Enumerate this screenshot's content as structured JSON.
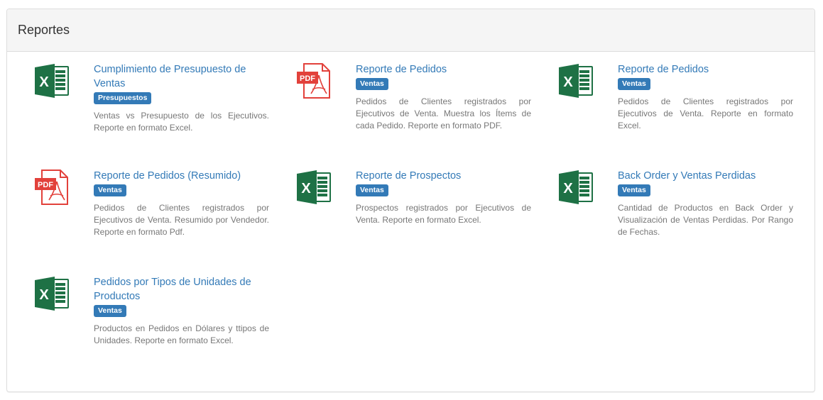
{
  "panel": {
    "title": "Reportes"
  },
  "reports": [
    {
      "icon": "excel-icon",
      "title": "Cumplimiento de Presupuesto de Ventas",
      "badge": "Presupuestos",
      "description": "Ventas vs Presupuesto de los Ejecutivos. Reporte en formato Excel."
    },
    {
      "icon": "pdf-icon",
      "title": "Reporte de Pedidos",
      "badge": "Ventas",
      "description": "Pedidos de Clientes registrados por Ejecutivos de Venta. Muestra los Ítems de cada Pedido. Reporte en formato PDF."
    },
    {
      "icon": "excel-icon",
      "title": "Reporte de Pedidos",
      "badge": "Ventas",
      "description": "Pedidos de Clientes registrados por Ejecutivos de Venta. Reporte en formato Excel."
    },
    {
      "icon": "pdf-icon",
      "title": "Reporte de Pedidos (Resumido)",
      "badge": "Ventas",
      "description": "Pedidos de Clientes registrados por Ejecutivos de Venta. Resumido por Vendedor. Reporte en formato Pdf."
    },
    {
      "icon": "excel-icon",
      "title": "Reporte de Prospectos",
      "badge": "Ventas",
      "description": "Prospectos registrados por Ejecutivos de Venta. Reporte en formato Excel."
    },
    {
      "icon": "excel-icon",
      "title": "Back Order y Ventas Perdidas",
      "badge": "Ventas",
      "description": "Cantidad de Productos en Back Order y Visualización de Ventas Perdidas. Por Rango de Fechas."
    },
    {
      "icon": "excel-icon",
      "title": "Pedidos por Tipos de Unidades de Productos",
      "badge": "Ventas",
      "description": "Productos en Pedidos en Dólares y ttipos de Unidades. Reporte en formato Excel."
    }
  ],
  "icon_labels": {
    "excel": "X",
    "pdf": "PDF"
  },
  "colors": {
    "link": "#337ab7",
    "badge": "#337ab7",
    "excel": "#1e7145",
    "pdf": "#e2413b"
  }
}
